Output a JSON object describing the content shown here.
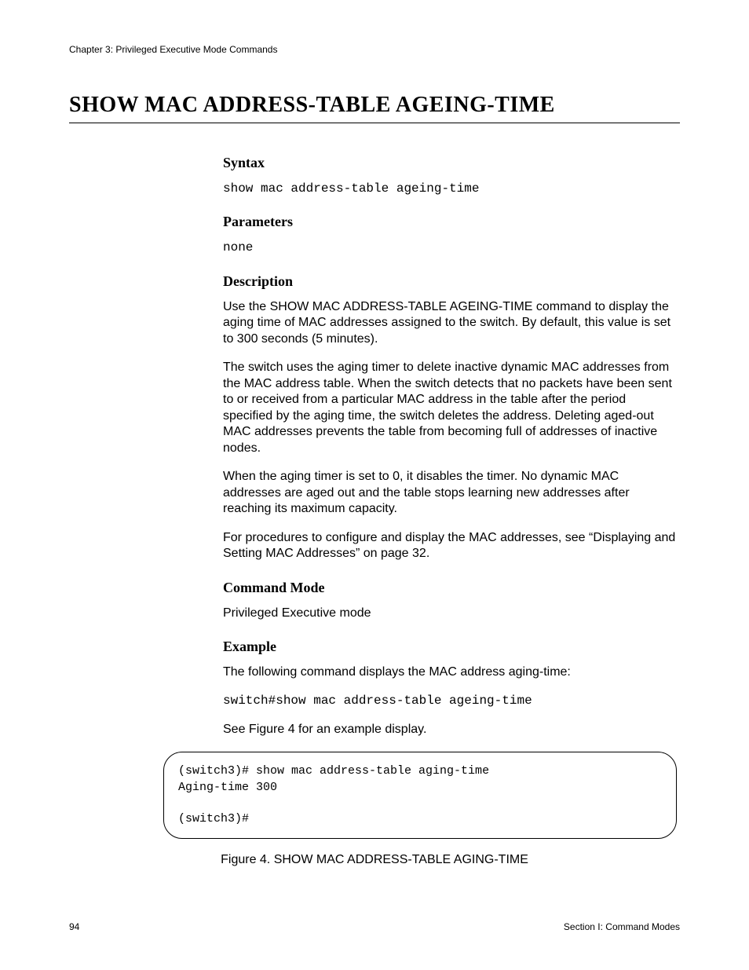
{
  "header": {
    "chapter_line": "Chapter 3: Privileged Executive Mode Commands"
  },
  "title": "SHOW MAC ADDRESS-TABLE AGEING-TIME",
  "sections": {
    "syntax": {
      "heading": "Syntax",
      "code": "show mac address-table ageing-time"
    },
    "parameters": {
      "heading": "Parameters",
      "code": "none"
    },
    "description": {
      "heading": "Description",
      "p1": "Use the SHOW MAC ADDRESS-TABLE AGEING-TIME command to display the aging time of MAC addresses assigned to the switch. By default, this value is set to 300 seconds (5 minutes).",
      "p2": "The switch uses the aging timer to delete inactive dynamic MAC addresses from the MAC address table. When the switch detects that no packets have been sent to or received from a particular MAC address in the table after the period specified by the aging time, the switch deletes the address. Deleting aged-out MAC addresses prevents the table from becoming full of addresses of inactive nodes.",
      "p3": "When the aging timer is set to 0, it disables the timer. No dynamic MAC addresses are aged out and the table stops learning new addresses after reaching its maximum capacity.",
      "p4": "For procedures to configure and display the MAC addresses, see “Displaying and Setting MAC Addresses” on page 32."
    },
    "command_mode": {
      "heading": "Command Mode",
      "text": "Privileged Executive mode"
    },
    "example": {
      "heading": "Example",
      "intro": "The following command displays the MAC address aging-time:",
      "code": "switch#show mac address-table ageing-time",
      "see": "See Figure 4 for an example display."
    }
  },
  "example_box": "(switch3)# show mac address-table aging-time\nAging-time 300\n\n(switch3)#",
  "figure_caption": "Figure 4. SHOW MAC ADDRESS-TABLE AGING-TIME",
  "footer": {
    "page_number": "94",
    "section_label": "Section I: Command Modes"
  }
}
